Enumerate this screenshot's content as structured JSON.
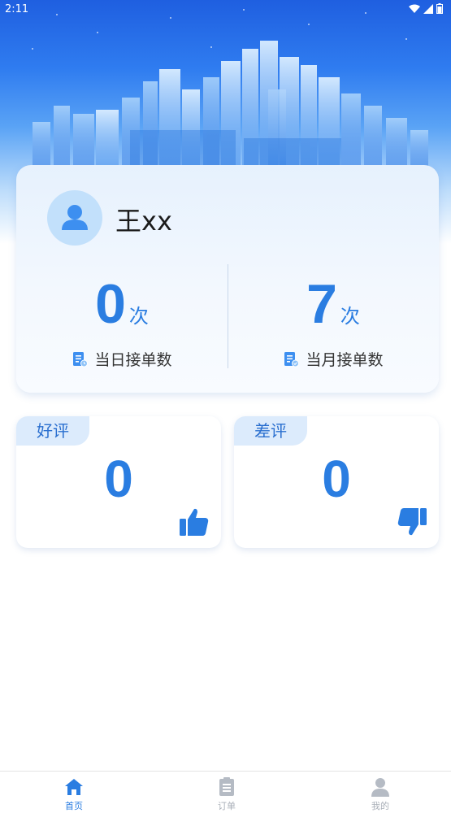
{
  "status_bar": {
    "time": "2:11"
  },
  "profile": {
    "name": "王xx"
  },
  "stats": [
    {
      "value": "0",
      "unit": "次",
      "label": "当日接单数"
    },
    {
      "value": "7",
      "unit": "次",
      "label": "当月接单数"
    }
  ],
  "reviews": {
    "good": {
      "label": "好评",
      "value": "0"
    },
    "bad": {
      "label": "差评",
      "value": "0"
    }
  },
  "tabs": [
    {
      "label": "首页",
      "icon": "home-icon",
      "active": true
    },
    {
      "label": "订单",
      "icon": "clipboard-icon",
      "active": false
    },
    {
      "label": "我的",
      "icon": "user-icon",
      "active": false
    }
  ],
  "colors": {
    "accent": "#2a7de1",
    "inactive": "#a9afb8",
    "tag_bg": "#dcebfc"
  }
}
